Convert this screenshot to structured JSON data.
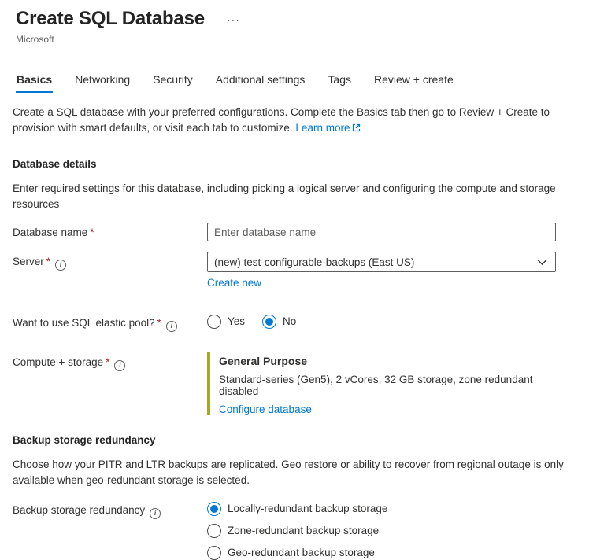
{
  "header": {
    "title": "Create SQL Database",
    "publisher": "Microsoft"
  },
  "icons": {
    "more": "···",
    "info": "i"
  },
  "required_marker": "*",
  "tabs": [
    {
      "label": "Basics",
      "selected": true
    },
    {
      "label": "Networking",
      "selected": false
    },
    {
      "label": "Security",
      "selected": false
    },
    {
      "label": "Additional settings",
      "selected": false
    },
    {
      "label": "Tags",
      "selected": false
    },
    {
      "label": "Review + create",
      "selected": false
    }
  ],
  "intro": {
    "text": "Create a SQL database with your preferred configurations. Complete the Basics tab then go to Review + Create to provision with smart defaults, or visit each tab to customize.",
    "learn_more_label": "Learn more"
  },
  "database_details": {
    "heading": "Database details",
    "description": "Enter required settings for this database, including picking a logical server and configuring the compute and storage resources"
  },
  "fields": {
    "database_name": {
      "label": "Database name",
      "placeholder": "Enter database name"
    },
    "server": {
      "label": "Server",
      "selected_value": "(new) test-configurable-backups (East US)",
      "create_new_label": "Create new"
    },
    "elastic_pool": {
      "label": "Want to use SQL elastic pool?",
      "options": [
        {
          "label": "Yes",
          "selected": false
        },
        {
          "label": "No",
          "selected": true
        }
      ]
    },
    "compute_storage": {
      "label": "Compute + storage",
      "tier": "General Purpose",
      "detail": "Standard-series (Gen5), 2 vCores, 32 GB storage, zone redundant disabled",
      "configure_label": "Configure database"
    }
  },
  "backup_section": {
    "heading": "Backup storage redundancy",
    "description": "Choose how your PITR and LTR backups are replicated. Geo restore or ability to recover from regional outage is only available when geo-redundant storage is selected.",
    "field": {
      "label": "Backup storage redundancy",
      "options": [
        {
          "label": "Locally-redundant backup storage",
          "selected": true
        },
        {
          "label": "Zone-redundant backup storage",
          "selected": false
        },
        {
          "label": "Geo-redundant backup storage",
          "selected": false
        }
      ]
    }
  },
  "colors": {
    "accent": "#0078d4",
    "required": "#a4262c",
    "tier_bar": "#a0aa23",
    "text": "#323130",
    "secondary_text": "#605e5c"
  }
}
